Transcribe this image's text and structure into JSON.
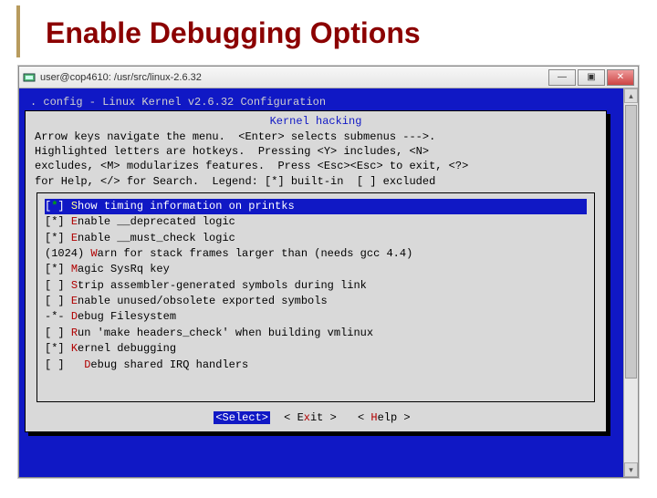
{
  "slide": {
    "title": "Enable Debugging Options"
  },
  "titlebar": {
    "text": "user@cop4610: /usr/src/linux-2.6.32"
  },
  "win_controls": {
    "minimize": "—",
    "maximize": "▣",
    "close": "✕"
  },
  "config_title": ". config - Linux Kernel v2.6.32 Configuration",
  "dialog": {
    "header": "Kernel hacking",
    "help": "Arrow keys navigate the menu.  <Enter> selects submenus --->.\nHighlighted letters are hotkeys.  Pressing <Y> includes, <N>\nexcludes, <M> modularizes features.  Press <Esc><Esc> to exit, <?>\nfor Help, </> for Search.  Legend: [*] built-in  [ ] excluded"
  },
  "menu": [
    {
      "prefix": "[",
      "mark": "*",
      "suffix": "] ",
      "hot": "S",
      "rest": "how timing information on printks",
      "selected": true,
      "green": true
    },
    {
      "prefix": "[*] ",
      "hot": "E",
      "rest": "nable __deprecated logic"
    },
    {
      "prefix": "[*] ",
      "hot": "E",
      "rest": "nable __must_check logic"
    },
    {
      "prefix": "(1024) ",
      "hot": "W",
      "rest": "arn for stack frames larger than (needs gcc 4.4)"
    },
    {
      "prefix": "[*] ",
      "hot": "M",
      "rest": "agic SysRq key"
    },
    {
      "prefix": "[ ] ",
      "hot": "S",
      "rest": "trip assembler-generated symbols during link"
    },
    {
      "prefix": "[ ] ",
      "hot": "E",
      "rest": "nable unused/obsolete exported symbols"
    },
    {
      "prefix": "-*- ",
      "hot": "D",
      "rest": "ebug Filesystem"
    },
    {
      "prefix": "[ ] ",
      "hot": "R",
      "rest": "un 'make headers_check' when building vmlinux"
    },
    {
      "prefix": "[*] ",
      "hot": "K",
      "rest": "ernel debugging"
    },
    {
      "prefix": "[ ]   ",
      "hot": "D",
      "rest": "ebug shared IRQ handlers"
    }
  ],
  "buttons": {
    "select": "<Select>",
    "exit_l": "< E",
    "exit_h": "x",
    "exit_r": "it >",
    "help_l": "< ",
    "help_h": "H",
    "help_r": "elp >"
  },
  "scroll": {
    "up": "▴",
    "down": "▾"
  }
}
